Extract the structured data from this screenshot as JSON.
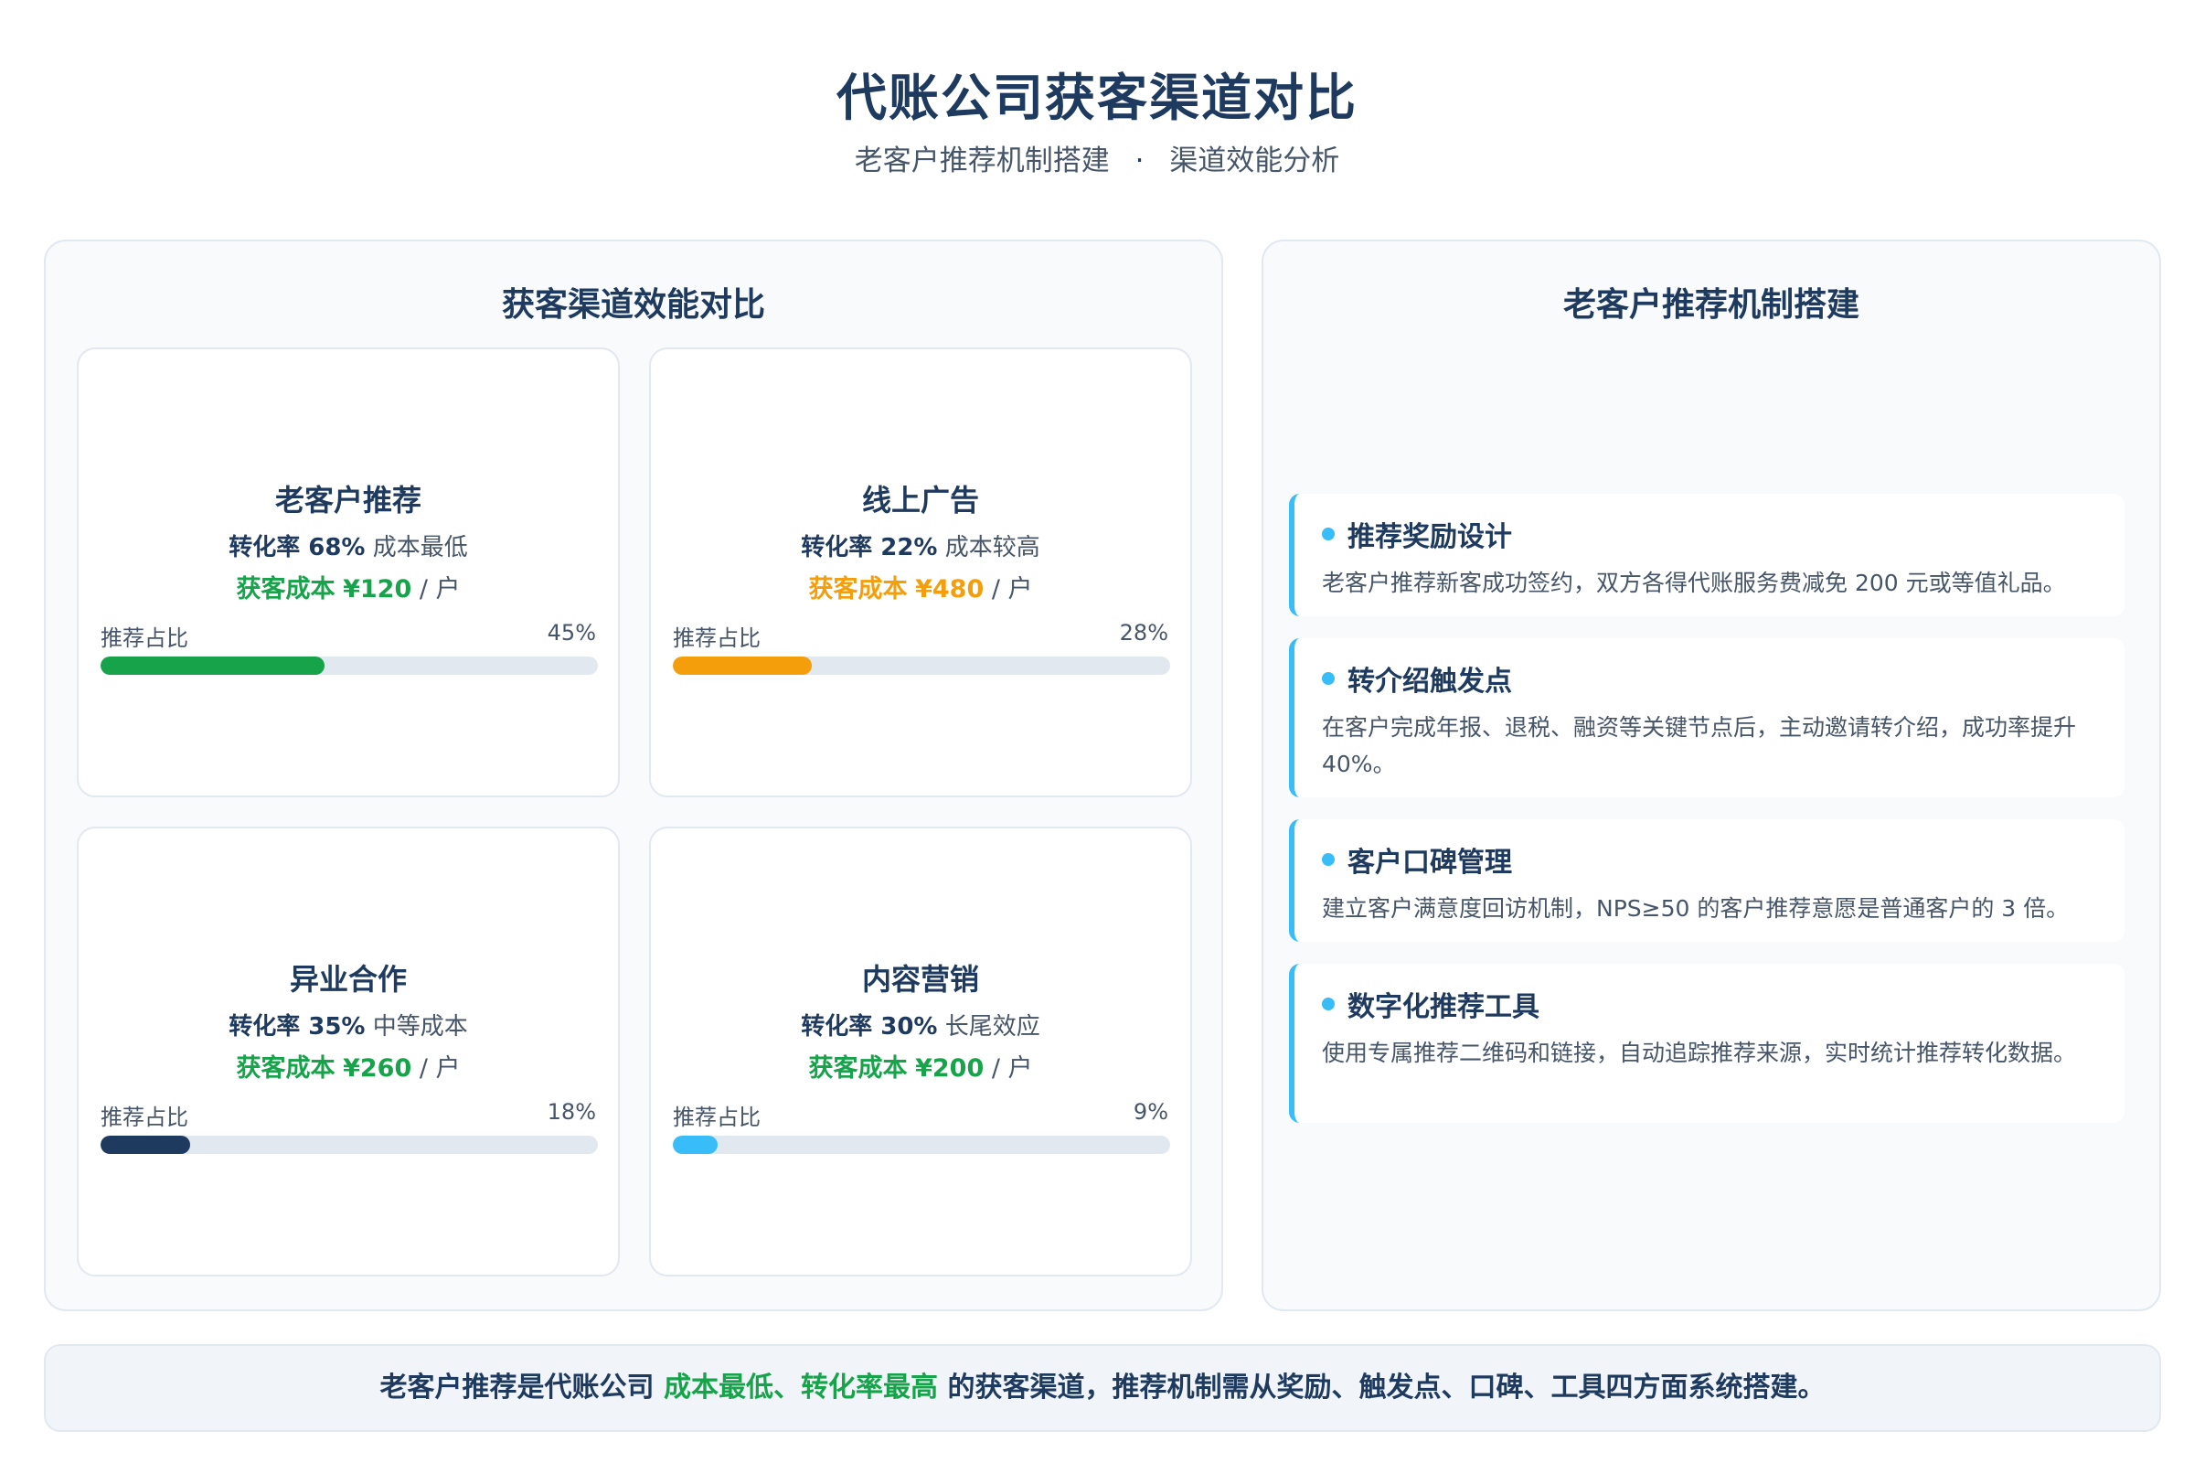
{
  "header": {
    "title": "代账公司获客渠道对比",
    "subtitle_left": "老客户推荐机制搭建",
    "subtitle_sep": "·",
    "subtitle_right": "渠道效能分析"
  },
  "left_panel": {
    "title": "获客渠道效能对比",
    "bar_label": "推荐占比",
    "cost_label": "获客成本",
    "cost_unit": "/ 户",
    "channels": [
      {
        "name": "老客户推荐",
        "rate": "转化率 68%",
        "note": "成本最低",
        "cost": "¥120",
        "share": "45%",
        "share_value": 45,
        "color": "#16a34a",
        "cost_color": "#16a34a"
      },
      {
        "name": "线上广告",
        "rate": "转化率 22%",
        "note": "成本较高",
        "cost": "¥480",
        "share": "28%",
        "share_value": 28,
        "color": "#f59e0b",
        "cost_color": "#f59e0b"
      },
      {
        "name": "异业合作",
        "rate": "转化率 35%",
        "note": "中等成本",
        "cost": "¥260",
        "share": "18%",
        "share_value": 18,
        "color": "#1e3a5f",
        "cost_color": "#16a34a"
      },
      {
        "name": "内容营销",
        "rate": "转化率 30%",
        "note": "长尾效应",
        "cost": "¥200",
        "share": "9%",
        "share_value": 9,
        "color": "#38bdf8",
        "cost_color": "#16a34a"
      }
    ]
  },
  "right_panel": {
    "title": "老客户推荐机制搭建",
    "items": [
      {
        "title": "推荐奖励设计",
        "desc": "老客户推荐新客成功签约，双方各得代账服务费减免 200 元或等值礼品。"
      },
      {
        "title": "转介绍触发点",
        "desc": "在客户完成年报、退税、融资等关键节点后，主动邀请转介绍，成功率提升 40%。"
      },
      {
        "title": "客户口碑管理",
        "desc": "建立客户满意度回访机制，NPS≥50 的客户推荐意愿是普通客户的 3 倍。"
      },
      {
        "title": "数字化推荐工具",
        "desc": "使用专属推荐二维码和链接，自动追踪推荐来源，实时统计推荐转化数据。"
      }
    ]
  },
  "footer": {
    "prefix": "老客户推荐是代账公司",
    "highlight": "成本最低、转化率最高",
    "suffix": "的获客渠道，推荐机制需从奖励、触发点、口碑、工具四方面系统搭建。"
  },
  "colors": {
    "accent": "#38bdf8",
    "green": "#16a34a",
    "orange": "#f59e0b",
    "navy": "#1e3a5f"
  }
}
